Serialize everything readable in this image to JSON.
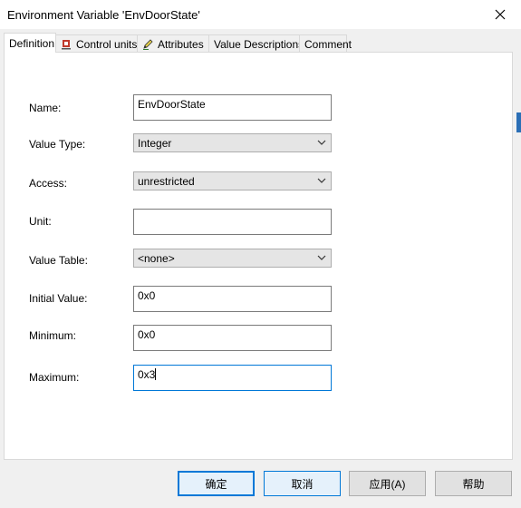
{
  "window": {
    "title": "Environment Variable 'EnvDoorState'"
  },
  "tabs": [
    {
      "label": "Definition",
      "icon": ""
    },
    {
      "label": "Control units",
      "icon": "ecu-icon"
    },
    {
      "label": "Attributes",
      "icon": "pencil-icon"
    },
    {
      "label": "Value Descriptions",
      "icon": ""
    },
    {
      "label": "Comment",
      "icon": ""
    }
  ],
  "form": {
    "name_label": "Name:",
    "name_value": "EnvDoorState",
    "value_type_label": "Value Type:",
    "value_type_value": "Integer",
    "access_label": "Access:",
    "access_value": "unrestricted",
    "unit_label": "Unit:",
    "unit_value": "",
    "value_table_label": "Value Table:",
    "value_table_value": "<none>",
    "initial_label": "Initial Value:",
    "initial_value": "0x0",
    "minimum_label": "Minimum:",
    "minimum_value": "0x0",
    "maximum_label": "Maximum:",
    "maximum_value": "0x3"
  },
  "buttons": {
    "ok": "确定",
    "cancel": "取消",
    "apply": "应用(A)",
    "help": "帮助"
  },
  "colors": {
    "accent": "#0078d7",
    "dialog_bg": "#f0f0f0"
  }
}
